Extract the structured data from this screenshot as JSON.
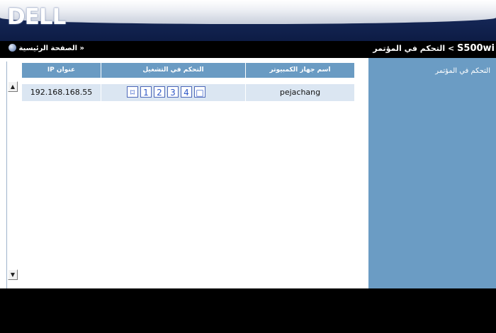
{
  "header": {
    "logo_text": "DELL"
  },
  "nav": {
    "home_label": "« الصفحة الرئيسية",
    "breadcrumb_current": "التحكم في المؤتمر",
    "breadcrumb_separator": "<",
    "breadcrumb_model": "S500wi"
  },
  "table": {
    "headers": {
      "ip": "عنوان IP",
      "control": "التحكم في التشغيل",
      "computer": "اسم جهاز الكمبيوتر"
    },
    "rows": [
      {
        "ip": "192.168.168.55",
        "computer": "pejachang"
      }
    ],
    "controls": [
      "⌑",
      "1",
      "2",
      "3",
      "4",
      "□"
    ]
  },
  "side": {
    "title": "التحكم في المؤتمر"
  },
  "colors": {
    "header_blue": "#0d1c45",
    "grid_header": "#6a9bc3",
    "row_bg": "#dbe6f2",
    "side_panel": "#6b9cc4"
  }
}
